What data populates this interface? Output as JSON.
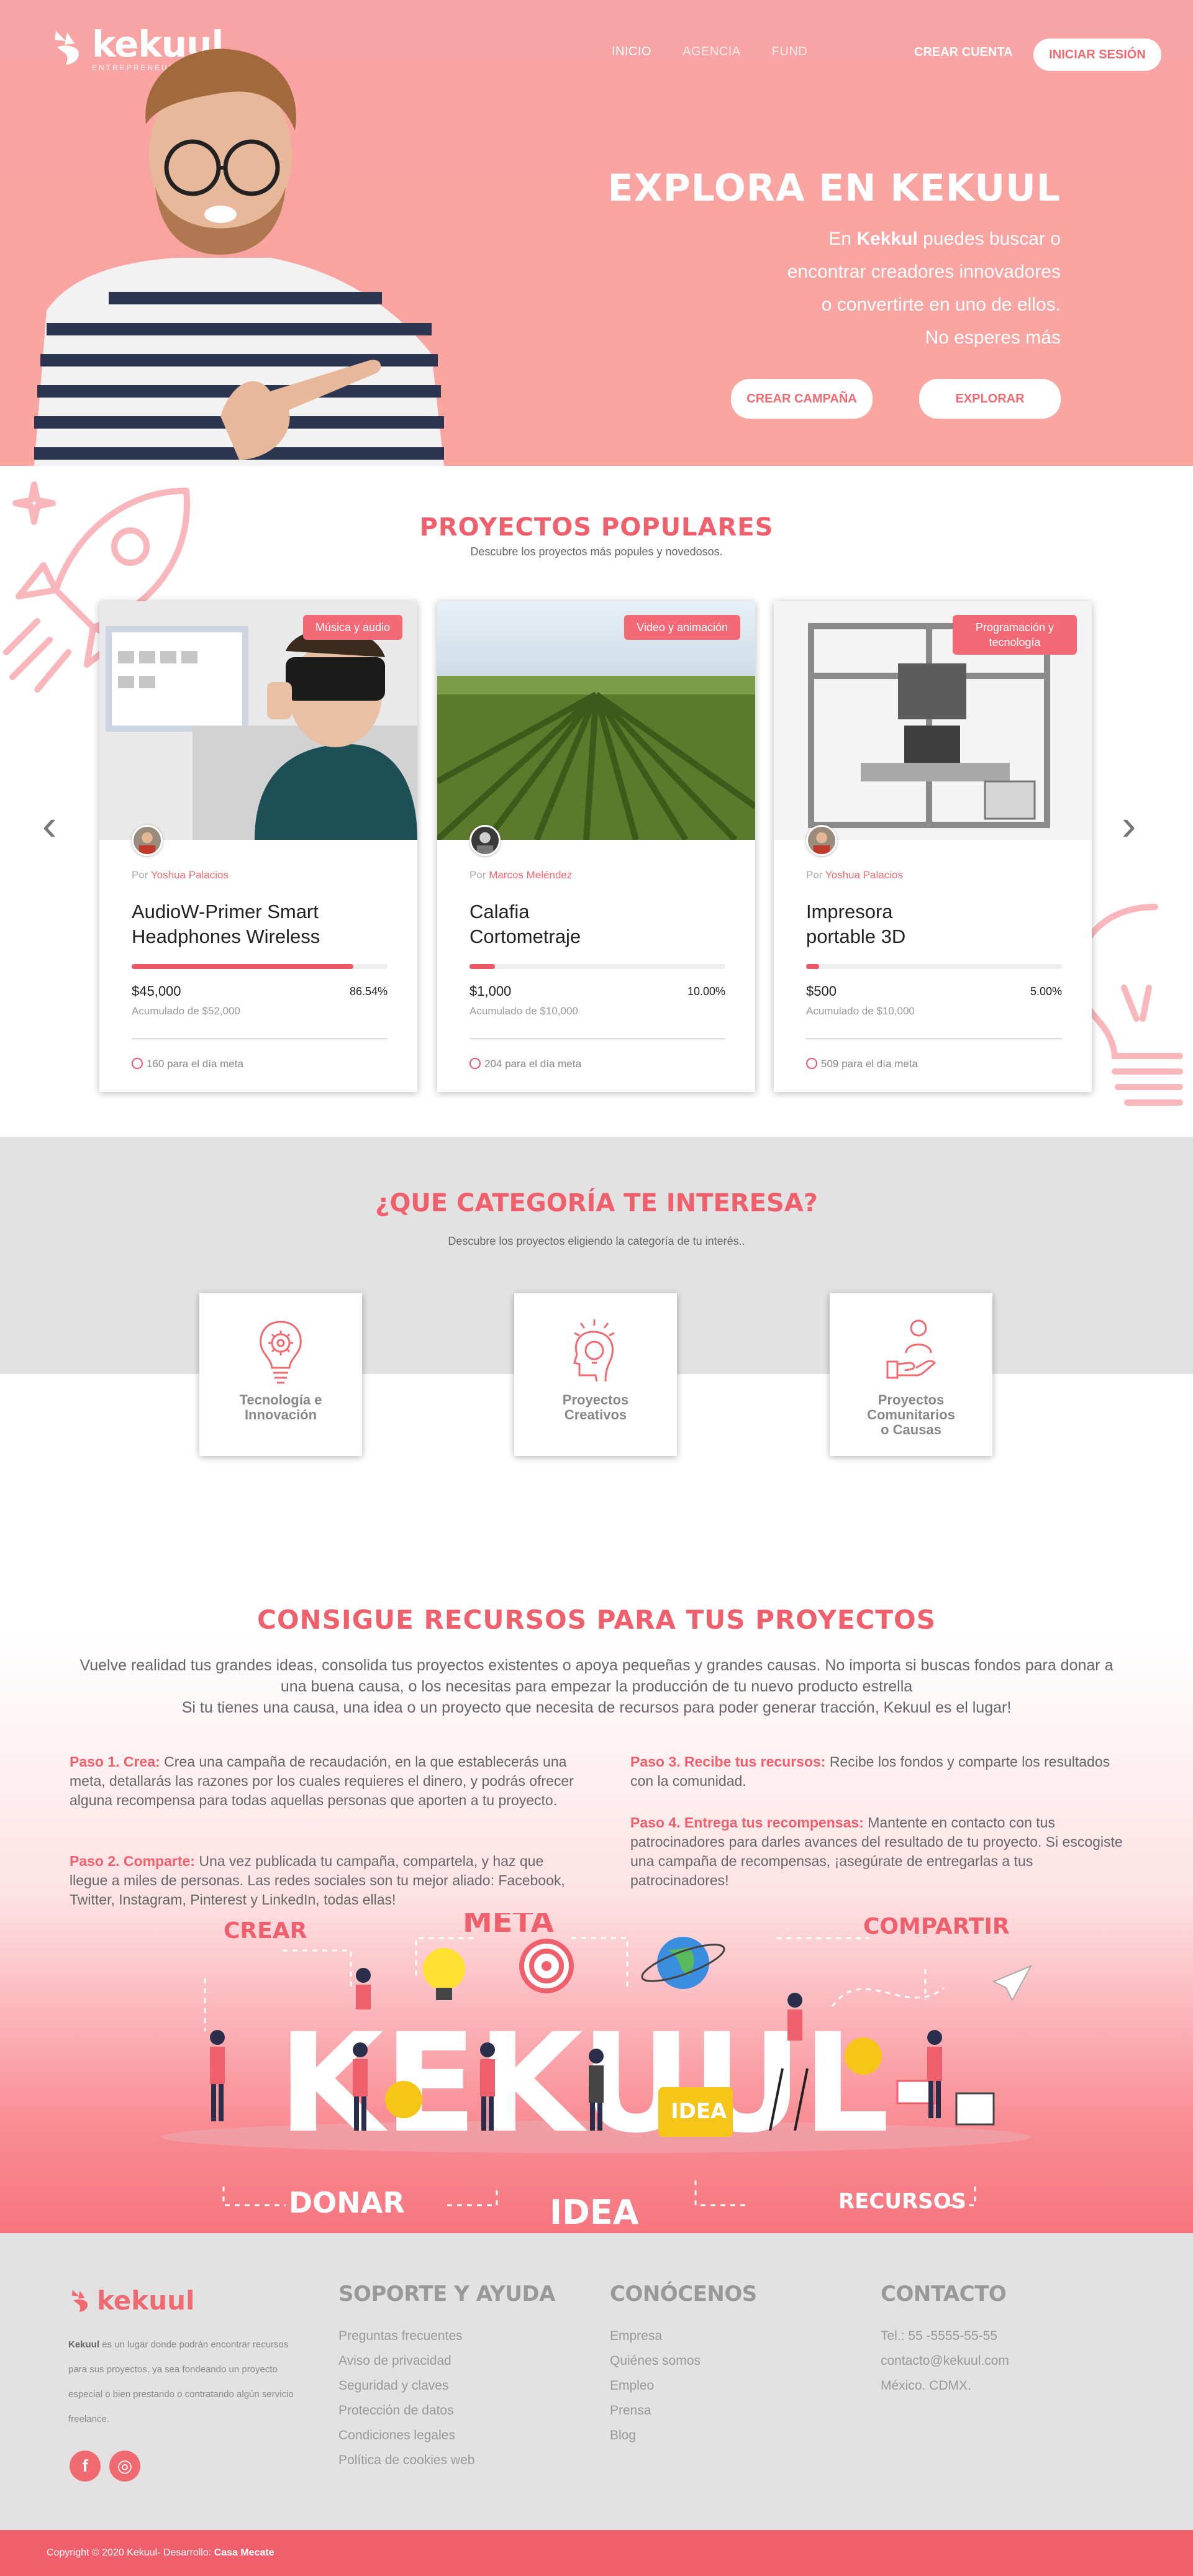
{
  "brand": {
    "name": "kekuul",
    "tagline": "ENTREPRENEUR HUB",
    "accent": "#f0606c",
    "hero_bg": "#f9a4a4"
  },
  "nav": {
    "items": [
      "INICIO",
      "AGENCIA",
      "FUND"
    ],
    "crear_cuenta": "CREAR CUENTA",
    "iniciar_sesion": "INICIAR SESIÓN"
  },
  "hero": {
    "title": "EXPLORA EN KEKUUL",
    "line1_pre": "En ",
    "line1_brand": "Kekkul",
    "line1_post": " puedes buscar o",
    "line2": "encontrar creadores innovadores",
    "line3": "o convertirte en uno de ellos.",
    "line4": "No esperes más",
    "btn_crear": "CREAR CAMPAÑA",
    "btn_explorar": "EXPLORAR"
  },
  "popular": {
    "title": "PROYECTOS POPULARES",
    "subtitle": "Descubre los proyectos más popules y novedosos.",
    "by_prefix": "Por ",
    "cards": [
      {
        "category": "Música y audio",
        "author": "Yoshua Palacios",
        "name": "AudioW-Primer Smart Headphones Wireless",
        "amount": "$45,000",
        "percent": "86.54%",
        "progress": 0.8654,
        "raised": "Acumulado de $52,000",
        "days": "160 para el día meta"
      },
      {
        "category": "Video y animación",
        "author": "Marcos Meléndez",
        "name": "Calafia Cortometraje",
        "amount": "$1,000",
        "percent": "10.00%",
        "progress": 0.1,
        "raised": "Acumulado de $10,000",
        "days": "204 para el día meta"
      },
      {
        "category": "Programación y tecnología",
        "author": "Yoshua Palacios",
        "name": "Impresora portable 3D",
        "amount": "$500",
        "percent": "5.00%",
        "progress": 0.05,
        "raised": "Acumulado de $10,000",
        "days": "509 para el día meta"
      }
    ]
  },
  "categories": {
    "title": "¿QUE CATEGORÍA TE INTERESA?",
    "subtitle": "Descubre los proyectos eligiendo la categoría de tu interés..",
    "items": [
      {
        "label1": "Tecnología e",
        "label2": "Innovación",
        "label3": "",
        "icon": "gear-bulb-icon"
      },
      {
        "label1": "Proyectos",
        "label2": "Creativos",
        "label3": "",
        "icon": "head-bulb-icon"
      },
      {
        "label1": "Proyectos",
        "label2": "Comunitarios",
        "label3": "o Causas",
        "icon": "hand-person-icon"
      }
    ]
  },
  "recursos": {
    "title": "CONSIGUE RECURSOS PARA TUS PROYECTOS",
    "intro1": "Vuelve realidad tus grandes ideas, consolida tus proyectos existentes o apoya pequeñas y grandes causas. No importa si buscas fondos para donar a",
    "intro2": "una buena causa, o los necesitas para empezar la producción de tu nuevo producto estrella",
    "intro3": "Si tu tienes una causa, una idea o un proyecto que necesita de recursos para poder generar tracción, Kekuul es el lugar!",
    "steps": [
      {
        "label": "Paso 1. Crea:",
        "text": " Crea una campaña de recaudación, en la que establecerás una meta, detallarás las razones por los cuales requieres el dinero, y podrás ofrecer alguna recompensa para todas aquellas personas que aporten a tu proyecto."
      },
      {
        "label": "Paso 2. Comparte:",
        "text": " Una vez publicada tu campaña, compartela, y haz que llegue a miles de personas. Las redes sociales son tu mejor aliado: Facebook, Twitter, Instagram, Pinterest y LinkedIn, todas ellas!"
      },
      {
        "label": "Paso 3. Recibe tus recursos:",
        "text": " Recibe los fondos y comparte los resultados con la comunidad."
      },
      {
        "label": "Paso 4. Entrega tus recompensas:",
        "text": " Mantente en contacto con tus patrocinadores para darles avances del resultado de tu proyecto. Si escogiste una campaña de recompensas, ¡asegúrate de entregarlas a tus patrocinadores!"
      }
    ],
    "illustration": {
      "crear": "CREAR",
      "meta": "META",
      "compartir": "COMPARTIR",
      "donar": "DONAR",
      "idea": "IDEA",
      "recursos": "RECURSOS",
      "big_word": "KEKUUL",
      "small_idea": "IDEA"
    }
  },
  "footer": {
    "logo": "kekuul",
    "desc_brand": "Kekuul",
    "desc": " es un lugar donde podrán encontrar recursos para sus proyectos, ya sea fondeando un proyecto especial o bien prestando o contratando algún servicio freelance.",
    "social": [
      {
        "icon": "facebook-icon",
        "glyph": "f"
      },
      {
        "icon": "instagram-icon",
        "glyph": "◎"
      }
    ],
    "columns": [
      {
        "title": "SOPORTE Y AYUDA",
        "items": [
          "Preguntas frecuentes",
          "Aviso de privacidad",
          "Seguridad y claves",
          "Protección de datos",
          "Condiciones legales",
          "Política de cookies web"
        ]
      },
      {
        "title": "CONÓCENOS",
        "items": [
          "Empresa",
          "Quiénes somos",
          "Empleo",
          "Prensa",
          "Blog"
        ]
      },
      {
        "title": "CONTACTO",
        "items": [
          "Tel.: 55 -5555-55-55",
          "contacto@kekuul.com",
          "México. CDMX."
        ]
      }
    ],
    "copyright": "Copyright © 2020 Kekuul- Desarrollo: ",
    "dev": "Casa Mecate"
  }
}
